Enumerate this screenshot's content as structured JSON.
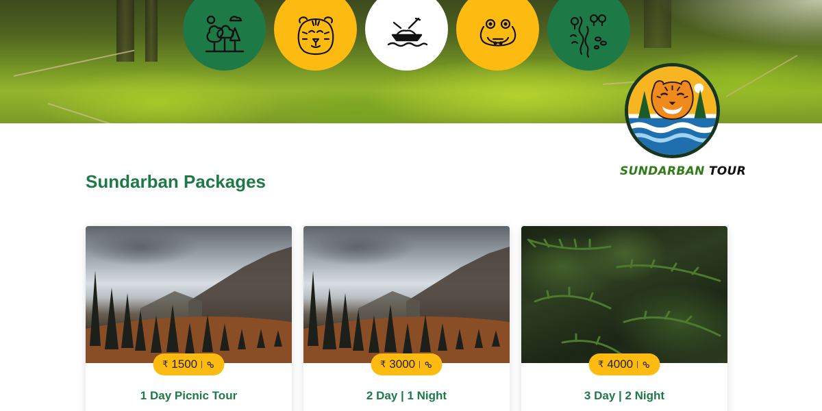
{
  "features": [
    {
      "icon": "forest-trees-icon",
      "style": "green"
    },
    {
      "icon": "tiger-face-icon",
      "style": "yellow"
    },
    {
      "icon": "boat-icon",
      "style": "white"
    },
    {
      "icon": "crocodile-icon",
      "style": "yellow"
    },
    {
      "icon": "river-trees-icon",
      "style": "green"
    }
  ],
  "brand": {
    "name_part1": "SUNDARBAN",
    "name_part2": "TOUR"
  },
  "section": {
    "title": "Sundarban Packages"
  },
  "packages": [
    {
      "currency": "₹",
      "price": "1500",
      "separator": "|",
      "title": "1 Day Picnic Tour",
      "photo": "mountain-forest"
    },
    {
      "currency": "₹",
      "price": "3000",
      "separator": "|",
      "title": "2 Day | 1 Night",
      "photo": "mountain-forest"
    },
    {
      "currency": "₹",
      "price": "4000",
      "separator": "|",
      "title": "3 Day | 2 Night",
      "photo": "fern-leaves"
    }
  ],
  "colors": {
    "brand_green": "#1d7a46",
    "accent_yellow": "#fdbb12",
    "logo_dark": "#16361f"
  }
}
